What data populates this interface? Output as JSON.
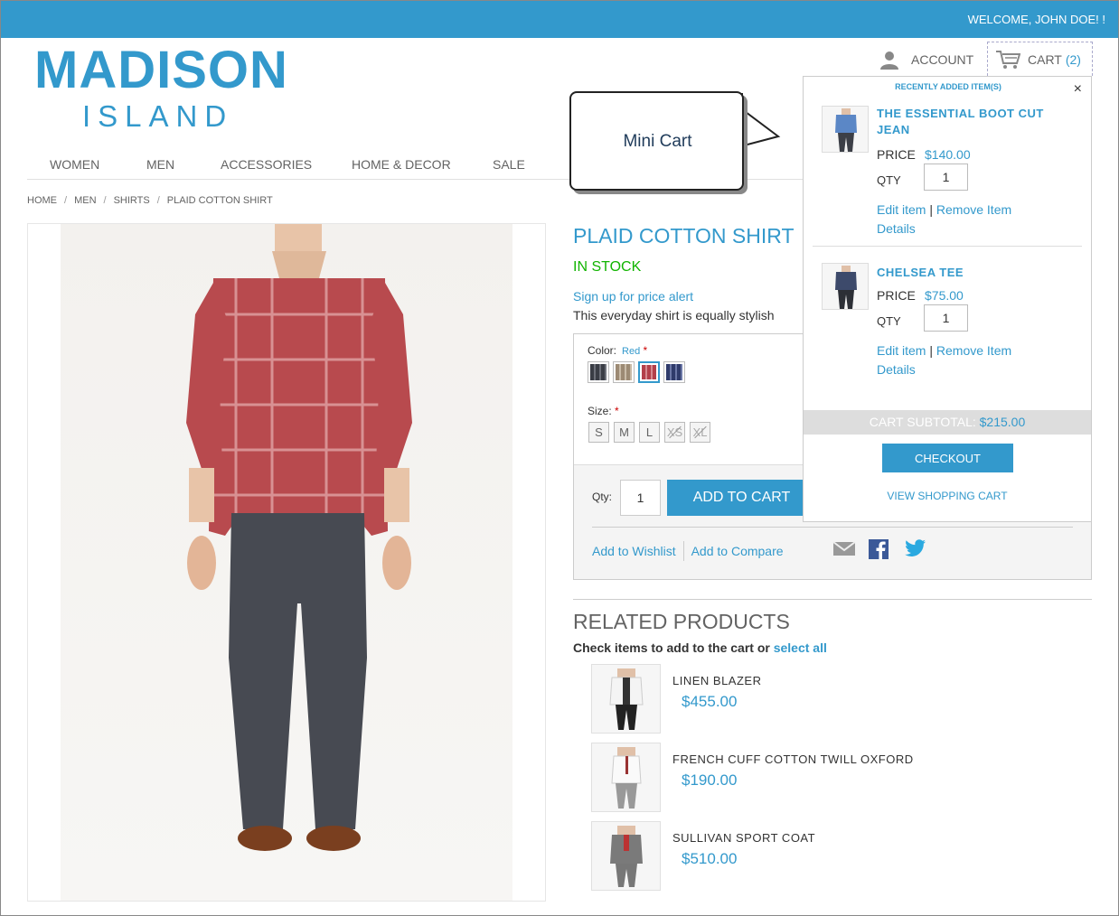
{
  "header": {
    "welcome": "WELCOME, JOHN DOE! !",
    "logo_main": "MADISON",
    "logo_sub": "ISLAND",
    "account_label": "ACCOUNT",
    "cart_label": "CART",
    "cart_count": "(2)"
  },
  "nav": [
    "WOMEN",
    "MEN",
    "ACCESSORIES",
    "HOME & DECOR",
    "SALE"
  ],
  "breadcrumb": [
    "HOME",
    "MEN",
    "SHIRTS",
    "PLAID COTTON SHIRT"
  ],
  "product": {
    "name": "PLAID COTTON SHIRT",
    "stock": "IN STOCK",
    "price_alert": "Sign up for price alert",
    "short_desc": "This everyday shirt is equally stylish",
    "color_label": "Color:",
    "color_value": "Red",
    "size_label": "Size:",
    "required_mark": "*",
    "sizes": [
      "S",
      "M",
      "L",
      "XS",
      "XL"
    ],
    "qty_label": "Qty:",
    "qty_value": "1",
    "add_to_cart": "ADD TO CART",
    "wishlist": "Add to Wishlist",
    "compare": "Add to Compare"
  },
  "colors": {
    "accent": "#3399cc",
    "in_stock": "#11b400"
  },
  "related": {
    "title": "RELATED PRODUCTS",
    "sub": "Check items to add to the cart or",
    "select_all": "select all",
    "items": [
      {
        "name": "LINEN BLAZER",
        "price": "$455.00"
      },
      {
        "name": "FRENCH CUFF COTTON TWILL OXFORD",
        "price": "$190.00"
      },
      {
        "name": "SULLIVAN SPORT COAT",
        "price": "$510.00"
      }
    ]
  },
  "callout": {
    "text": "Mini Cart"
  },
  "minicart": {
    "recent": "RECENTLY ADDED ITEM(S)",
    "close": "×",
    "price_label": "PRICE",
    "qty_label": "QTY",
    "edit": "Edit item",
    "remove": "Remove Item",
    "details": "Details",
    "items": [
      {
        "name": "THE ESSENTIAL BOOT CUT JEAN",
        "price": "$140.00",
        "qty": "1"
      },
      {
        "name": "CHELSEA TEE",
        "price": "$75.00",
        "qty": "1"
      }
    ],
    "subtotal_label": "CART SUBTOTAL:",
    "subtotal": "$215.00",
    "checkout": "CHECKOUT",
    "view_cart": "VIEW SHOPPING CART"
  }
}
